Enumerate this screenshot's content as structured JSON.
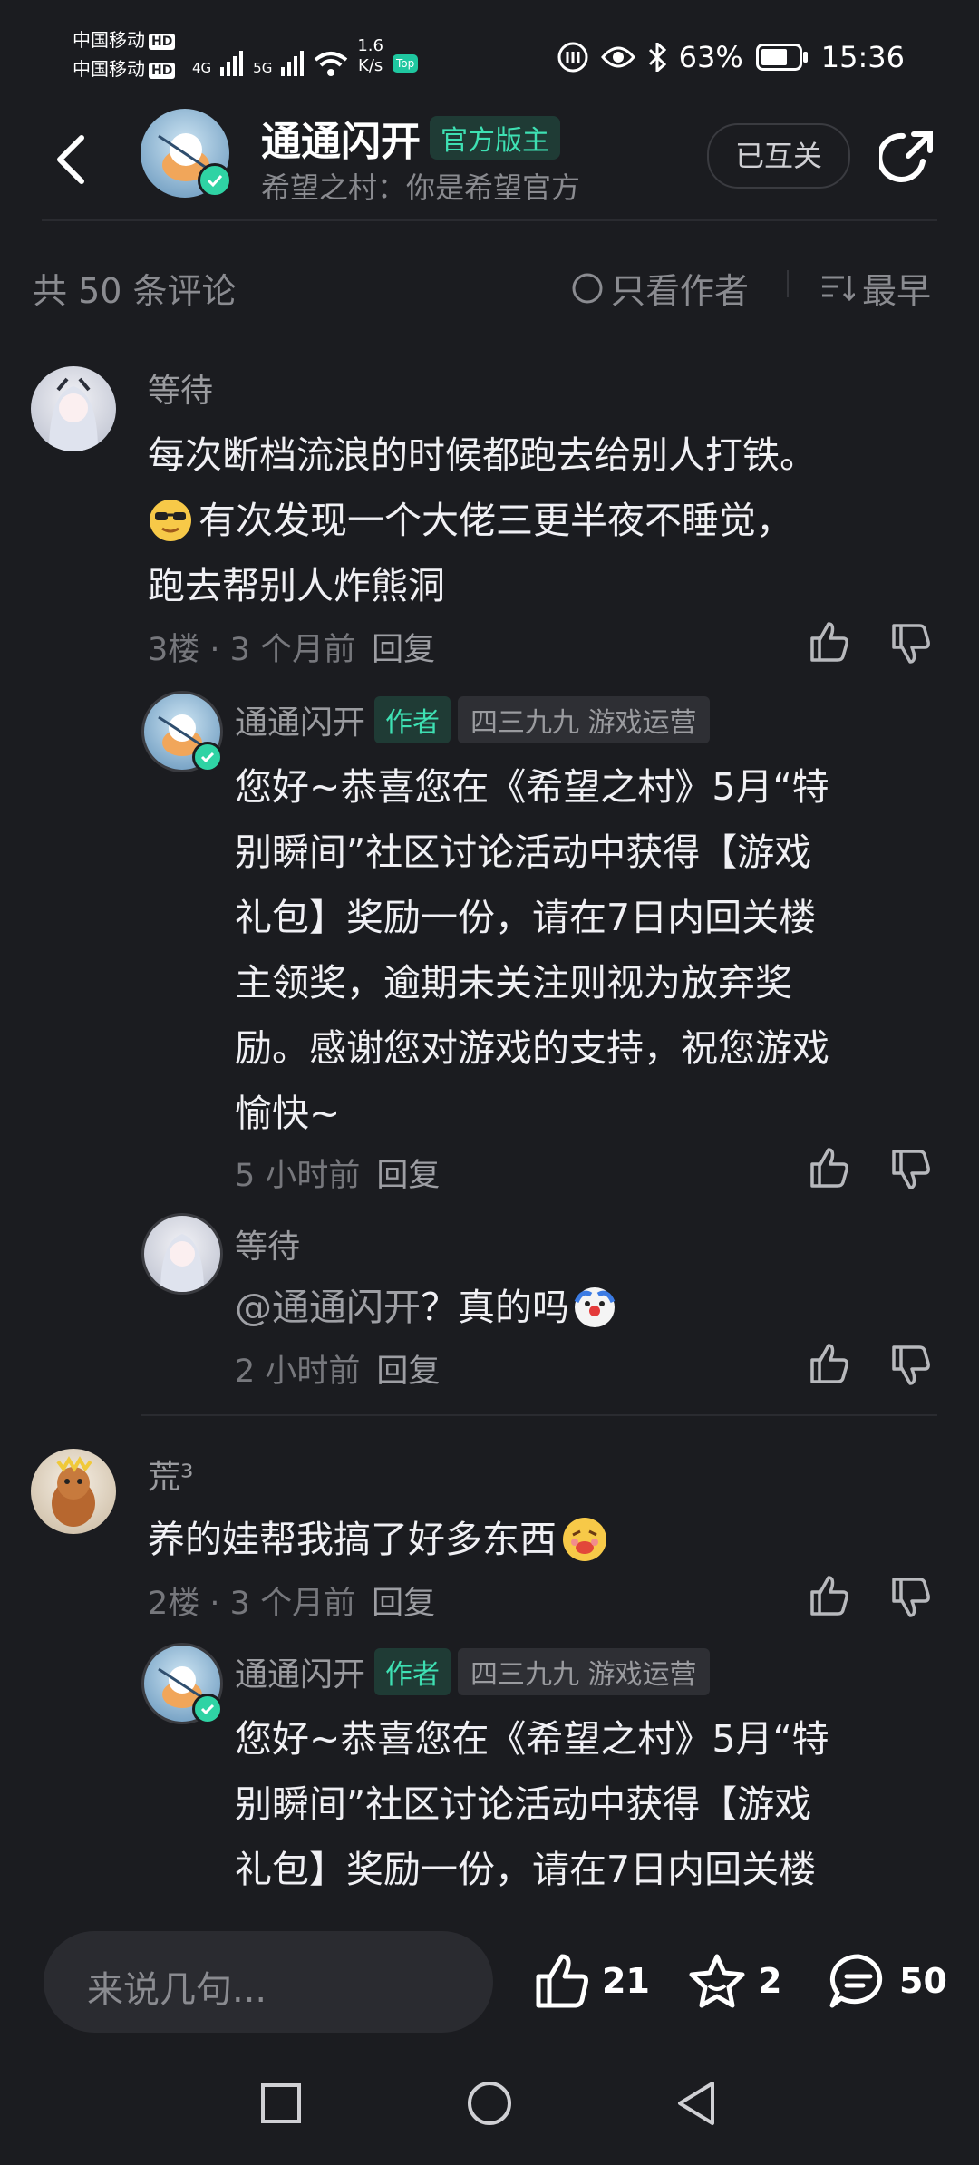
{
  "status_bar": {
    "carrier1": "中国移动",
    "carrier2": "中国移动",
    "hd": "HD",
    "net1": "4G",
    "net2": "5G",
    "speed": "1.6",
    "speed_unit": "K/s",
    "top": "Top",
    "battery": "63%",
    "time": "15:36"
  },
  "header": {
    "title": "通通闪开",
    "badge": "官方版主",
    "subtitle": "希望之村：你是希望官方",
    "follow_label": "已互关"
  },
  "filter_bar": {
    "count": "共 50 条评论",
    "only_author": "只看作者",
    "sort": "最早"
  },
  "comments": [
    {
      "user": "等待",
      "text_lines": [
        "每次断档流浪的时候都跑去给别人打铁。",
        "有次发现一个大佬三更半夜不睡觉，",
        "跑去帮别人炸熊洞"
      ],
      "floor": "3楼",
      "time": "3 个月前",
      "reply": "回复",
      "replies": [
        {
          "user": "通通闪开",
          "tag": "作者",
          "role": "四三九九 游戏运营",
          "text_lines": [
            "您好~恭喜您在《希望之村》5月“特",
            "别瞬间”社区讨论活动中获得【游戏",
            "礼包】奖励一份，请在7日内回关楼",
            "主领奖，逾期未关注则视为放弃奖",
            "励。感谢您对游戏的支持，祝您游戏",
            "愉快~"
          ],
          "time": "5 小时前",
          "reply": "回复"
        },
        {
          "user": "等待",
          "mention": "@通通闪开",
          "text": " ？真的吗",
          "time": "2 小时前",
          "reply": "回复"
        }
      ]
    },
    {
      "user": "荒³",
      "text": "养的娃帮我搞了好多东西",
      "floor": "2楼",
      "time": "3 个月前",
      "reply": "回复",
      "replies": [
        {
          "user": "通通闪开",
          "tag": "作者",
          "role": "四三九九 游戏运营",
          "text_lines": [
            "您好~恭喜您在《希望之村》5月“特",
            "别瞬间”社区讨论活动中获得【游戏",
            "礼包】奖励一份，请在7日内回关楼"
          ]
        }
      ]
    }
  ],
  "bottom_bar": {
    "input_placeholder": "来说几句...",
    "likes": "21",
    "favorites": "2",
    "comments": "50"
  },
  "colors": {
    "background": "#1b1c20",
    "accent": "#3ee0b3",
    "muted": "#76777c"
  }
}
